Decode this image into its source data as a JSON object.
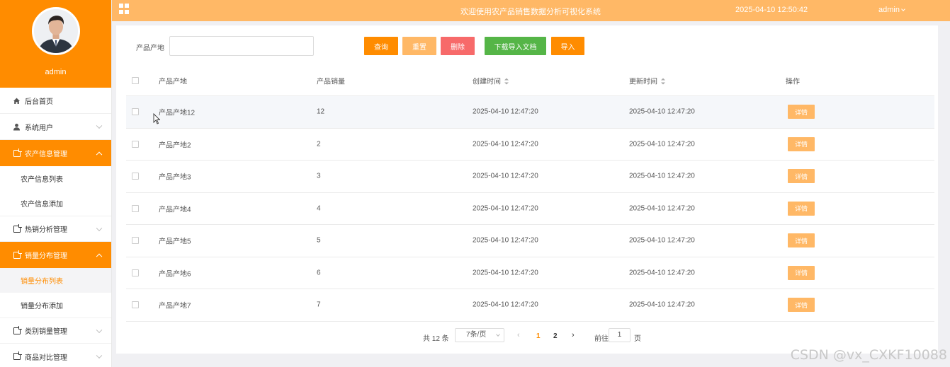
{
  "profile": {
    "name": "admin"
  },
  "topbar": {
    "title": "欢迎使用农产品销售数据分析可视化系统",
    "datetime": "2025-04-10 12:50:42",
    "user": "admin"
  },
  "sidebar": {
    "items": [
      {
        "label": "后台首页",
        "icon": "home-icon"
      },
      {
        "label": "系统用户",
        "icon": "user-icon"
      },
      {
        "label": "农产信息管理",
        "icon": "box-icon",
        "children": [
          "农产信息列表",
          "农产信息添加"
        ]
      },
      {
        "label": "热销分析管理",
        "icon": "box-icon"
      },
      {
        "label": "销量分布管理",
        "icon": "box-icon",
        "children": [
          "销量分布列表",
          "销量分布添加"
        ]
      },
      {
        "label": "类别销量管理",
        "icon": "box-icon"
      },
      {
        "label": "商品对比管理",
        "icon": "box-icon"
      }
    ]
  },
  "search": {
    "label": "产品产地",
    "value": "",
    "placeholder": ""
  },
  "buttons": {
    "query": "查询",
    "reset": "重置",
    "delete": "删除",
    "download": "下载导入文档",
    "import": "导入"
  },
  "table": {
    "columns": [
      "产品产地",
      "产品销量",
      "创建时间",
      "更新时间",
      "操作"
    ],
    "detail_label": "详情",
    "rows": [
      {
        "place": "产品产地12",
        "sales": "12",
        "created": "2025-04-10 12:47:20",
        "updated": "2025-04-10 12:47:20"
      },
      {
        "place": "产品产地2",
        "sales": "2",
        "created": "2025-04-10 12:47:20",
        "updated": "2025-04-10 12:47:20"
      },
      {
        "place": "产品产地3",
        "sales": "3",
        "created": "2025-04-10 12:47:20",
        "updated": "2025-04-10 12:47:20"
      },
      {
        "place": "产品产地4",
        "sales": "4",
        "created": "2025-04-10 12:47:20",
        "updated": "2025-04-10 12:47:20"
      },
      {
        "place": "产品产地5",
        "sales": "5",
        "created": "2025-04-10 12:47:20",
        "updated": "2025-04-10 12:47:20"
      },
      {
        "place": "产品产地6",
        "sales": "6",
        "created": "2025-04-10 12:47:20",
        "updated": "2025-04-10 12:47:20"
      },
      {
        "place": "产品产地7",
        "sales": "7",
        "created": "2025-04-10 12:47:20",
        "updated": "2025-04-10 12:47:20"
      }
    ]
  },
  "pagination": {
    "total": "共 12 条",
    "page_size": "7条/页",
    "pages": [
      "1",
      "2"
    ],
    "current": "1",
    "goto_label": "前往",
    "goto_value": "1",
    "page_suffix": "页"
  },
  "watermark": "CSDN @vx_CXKF10088",
  "colors": {
    "accent": "#ff8c00",
    "accent_light": "#ffb866",
    "danger": "#f76a6a",
    "success": "#55b547"
  }
}
